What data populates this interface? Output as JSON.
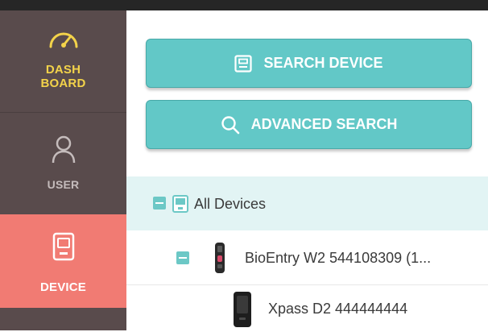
{
  "sidebar": {
    "items": [
      {
        "label_line1": "DASH",
        "label_line2": "BOARD",
        "icon": "gauge-icon",
        "color": "#f3d34a"
      },
      {
        "label": "USER",
        "icon": "user-icon",
        "color": "#c5bcbc"
      },
      {
        "label": "DEVICE",
        "icon": "device-icon",
        "active": true,
        "color": "#f17b73"
      }
    ]
  },
  "toggle": {
    "glyph": "›"
  },
  "buttons": {
    "search_device": "SEARCH DEVICE",
    "advanced_search": "ADVANCED SEARCH"
  },
  "tree": {
    "all_devices": "All Devices",
    "nodes": [
      {
        "label": "BioEntry W2 544108309 (1..."
      },
      {
        "label": "Xpass D2 444444444"
      }
    ]
  },
  "colors": {
    "accent": "#62c8c7",
    "sidebar": "#594b4c",
    "active": "#f17b73",
    "tree_highlight": "#e2f4f4"
  }
}
